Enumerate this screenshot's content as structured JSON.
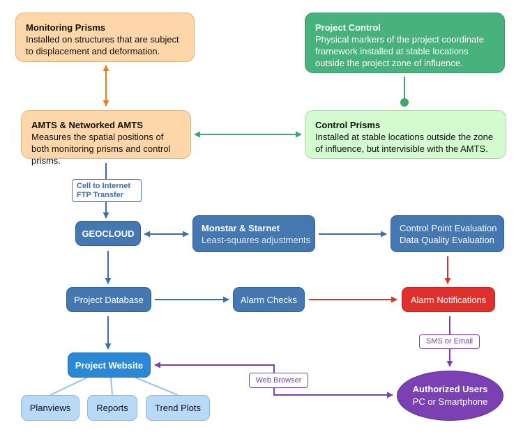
{
  "colors": {
    "orange": "#fdd6aa",
    "dark_green": "#47b27b",
    "light_green": "#d3fbcf",
    "blue": "#4577b0",
    "red": "#e0302b",
    "website_blue": "#2a88d6",
    "light_blue": "#b9d9f9",
    "purple": "#7b40b3"
  },
  "nodes": {
    "monitoring_prisms": {
      "title": "Monitoring Prisms",
      "text": "Installed on structures that are subject to displacement and deformation."
    },
    "amts": {
      "title": "AMTS & Networked AMTS",
      "text": "Measures the spatial positions of both monitoring prisms and control prisms."
    },
    "project_control": {
      "title": "Project Control",
      "text": "Physical markers of the project coordinate framework installed at stable locations outside the project zone of influence."
    },
    "control_prisms": {
      "title": "Control Prisms",
      "text": "Installed at stable locations outside the zone of influence, but intervisible with the AMTS."
    },
    "geocloud": {
      "label": "GEOCLOUD"
    },
    "monstar": {
      "title": "Monstar & Starnet",
      "text": "Least-squares adjustments"
    },
    "evaluation": {
      "line1": "Control Point Evaluation",
      "line2": "Data Quality Evaluation"
    },
    "project_database": {
      "label": "Project Database"
    },
    "alarm_checks": {
      "label": "Alarm Checks"
    },
    "alarm_notifications": {
      "label": "Alarm Notifications"
    },
    "project_website": {
      "label": "Project Website"
    },
    "planviews": {
      "label": "Planviews"
    },
    "reports": {
      "label": "Reports"
    },
    "trend_plots": {
      "label": "Trend Plots"
    },
    "authorized_users": {
      "title": "Authorized Users",
      "text": "PC or Smartphone"
    }
  },
  "edge_labels": {
    "cell_line1": "Cell to Internet",
    "cell_line2": "FTP Transfer",
    "sms": "SMS or Email",
    "web_browser": "Web Browser"
  }
}
